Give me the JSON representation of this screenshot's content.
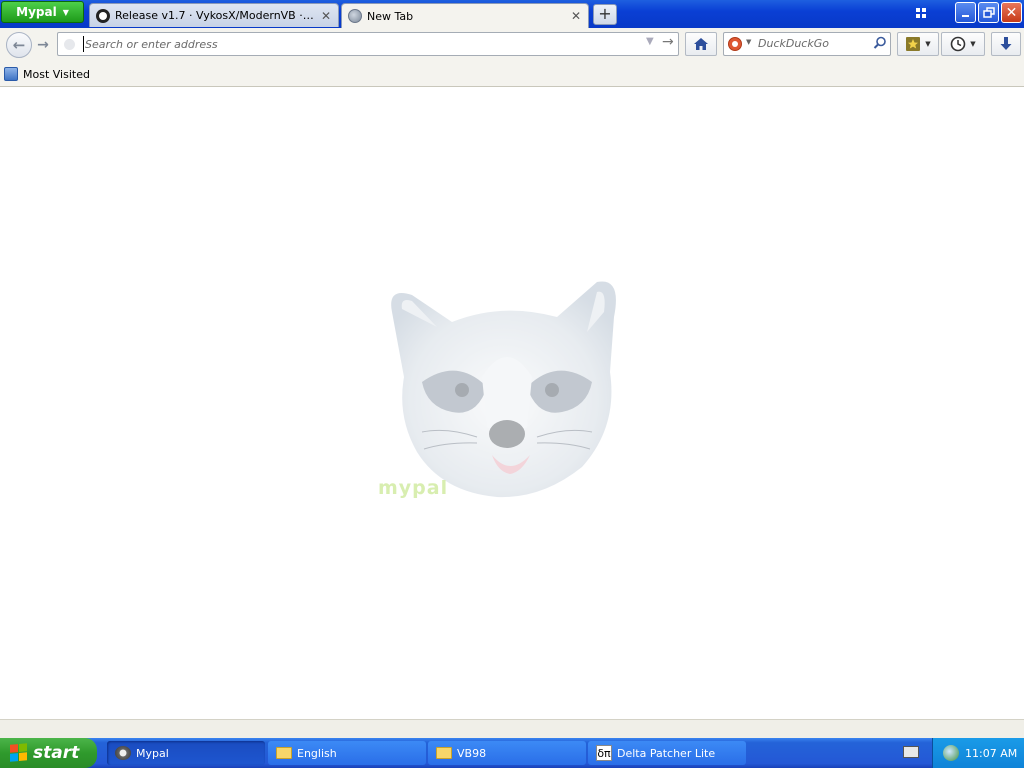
{
  "app": {
    "menu_button_label": "Mypal"
  },
  "tabs": [
    {
      "title": "Release v1.7 · VykosX/ModernVB · GitHub",
      "favicon": "github-icon",
      "active": false
    },
    {
      "title": "New Tab",
      "favicon": "globe-icon",
      "active": true
    }
  ],
  "navbar": {
    "url_placeholder": "Search or enter address",
    "search_placeholder": "DuckDuckGo",
    "search_engine": "duckduckgo-icon"
  },
  "bookmarks_bar": {
    "items": [
      {
        "label": "Most Visited",
        "icon": "most-visited-icon"
      }
    ]
  },
  "content": {
    "wordmark": "mypal"
  },
  "taskbar": {
    "start_label": "start",
    "windows": [
      {
        "label": "Mypal",
        "icon": "raccoon-icon",
        "active": true
      },
      {
        "label": "English",
        "icon": "folder-icon",
        "active": false
      },
      {
        "label": "VB98",
        "icon": "folder-icon",
        "active": false
      },
      {
        "label": "Delta Patcher Lite",
        "icon": "delta-patcher-icon",
        "active": false
      }
    ],
    "clock": "11:07 AM"
  },
  "colors": {
    "titlebar": "#0a3fd4",
    "app_button": "#2fb02b",
    "taskbar": "#2458d6",
    "start_button": "#2f9a2c",
    "tray": "#0f83d8"
  }
}
